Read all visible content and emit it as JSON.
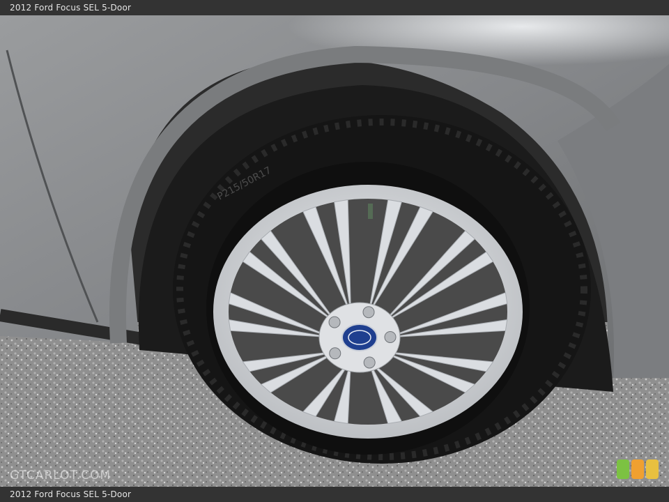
{
  "header": {
    "title": "2012 Ford Focus SEL 5-Door"
  },
  "footer": {
    "caption": "2012 Ford Focus SEL 5-Door"
  },
  "photo": {
    "tire_sidewall_text": "P215/50R17",
    "hub_badge_icon": "ford-oval-icon"
  },
  "watermark": {
    "text": "GTCARLOT.COM"
  },
  "colors": {
    "body_paint": "#8a8c8e",
    "tire": "#141414",
    "rim": "#d6d8dc",
    "badge": "#1f3f8f",
    "gravel": "#9a9a9a"
  },
  "logo": {
    "icon": "traffic-light-logo-icon",
    "colors": [
      "#7cc242",
      "#f0a030",
      "#e8c040"
    ]
  }
}
